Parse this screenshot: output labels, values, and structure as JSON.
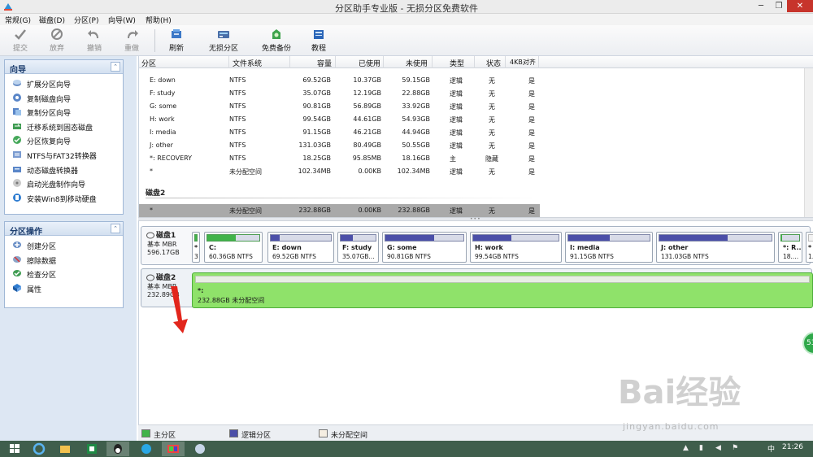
{
  "window": {
    "title": "分区助手专业版 - 无损分区免费软件",
    "minimize": "─",
    "maximize": "❐",
    "close": "✕"
  },
  "menu": [
    "常规(G)",
    "磁盘(D)",
    "分区(P)",
    "向导(W)",
    "帮助(H)"
  ],
  "toolbar": {
    "commit": "提交",
    "discard": "放弃",
    "undo": "撤销",
    "redo": "重做",
    "refresh": "刷新",
    "lossless": "无损分区",
    "backup": "免费备份",
    "tutorial": "教程"
  },
  "wizard": {
    "title": "向导",
    "collapse": "⌃",
    "items": [
      "扩展分区向导",
      "复制磁盘向导",
      "复制分区向导",
      "迁移系统到固态磁盘",
      "分区恢复向导",
      "NTFS与FAT32转换器",
      "动态磁盘转换器",
      "启动光盘制作向导",
      "安装Win8到移动硬盘"
    ]
  },
  "partition_ops": {
    "title": "分区操作",
    "collapse": "⌃",
    "items": [
      "创建分区",
      "擦除数据",
      "检查分区",
      "属性"
    ]
  },
  "table": {
    "headers": [
      "分区",
      "文件系统",
      "容量",
      "已使用",
      "未使用",
      "类型",
      "状态",
      "4KB对齐"
    ],
    "rows": [
      [
        "E: down",
        "NTFS",
        "69.52GB",
        "10.37GB",
        "59.15GB",
        "逻辑",
        "无",
        "是"
      ],
      [
        "F: study",
        "NTFS",
        "35.07GB",
        "12.19GB",
        "22.88GB",
        "逻辑",
        "无",
        "是"
      ],
      [
        "G: some",
        "NTFS",
        "90.81GB",
        "56.89GB",
        "33.92GB",
        "逻辑",
        "无",
        "是"
      ],
      [
        "H: work",
        "NTFS",
        "99.54GB",
        "44.61GB",
        "54.93GB",
        "逻辑",
        "无",
        "是"
      ],
      [
        "I: media",
        "NTFS",
        "91.15GB",
        "46.21GB",
        "44.94GB",
        "逻辑",
        "无",
        "是"
      ],
      [
        "J: other",
        "NTFS",
        "131.03GB",
        "80.49GB",
        "50.55GB",
        "逻辑",
        "无",
        "是"
      ],
      [
        "*: RECOVERY",
        "NTFS",
        "18.25GB",
        "95.85MB",
        "18.16GB",
        "主",
        "隐藏",
        "是"
      ],
      [
        "*",
        "未分配空间",
        "102.34MB",
        "0.00KB",
        "102.34MB",
        "逻辑",
        "无",
        "是"
      ]
    ],
    "disk2_label": "磁盘2",
    "disk2_row": [
      "*",
      "未分配空间",
      "232.88GB",
      "0.00KB",
      "232.88GB",
      "逻辑",
      "无",
      "是"
    ]
  },
  "disk1": {
    "name": "磁盘1",
    "type": "基本 MBR",
    "size": "596.17GB",
    "partitions": [
      {
        "name": "*",
        "size": "3",
        "kind": "primary",
        "used": 0.9
      },
      {
        "name": "C:",
        "size": "60.36GB NTFS",
        "kind": "primary",
        "used": 0.55
      },
      {
        "name": "E: down",
        "size": "69.52GB NTFS",
        "kind": "logic",
        "used": 0.15
      },
      {
        "name": "F: study",
        "size": "35.07GB...",
        "kind": "logic",
        "used": 0.35
      },
      {
        "name": "G: some",
        "size": "90.81GB NTFS",
        "kind": "logic",
        "used": 0.63
      },
      {
        "name": "H: work",
        "size": "99.54GB NTFS",
        "kind": "logic",
        "used": 0.45
      },
      {
        "name": "I: media",
        "size": "91.15GB NTFS",
        "kind": "logic",
        "used": 0.51
      },
      {
        "name": "J: other",
        "size": "131.03GB NTFS",
        "kind": "logic",
        "used": 0.61
      },
      {
        "name": "*: R...",
        "size": "18....",
        "kind": "primary",
        "used": 0.05
      },
      {
        "name": "*",
        "size": "1.",
        "kind": "unalloc",
        "used": 0
      }
    ]
  },
  "disk2": {
    "name": "磁盘2",
    "type": "基本 MBR",
    "size": "232.89GB",
    "partition_name": "*:",
    "partition_size": "232.88GB 未分配空间"
  },
  "legend": {
    "primary": "主分区",
    "logic": "逻辑分区",
    "unalloc": "未分配空间"
  },
  "taskbar": {
    "clock": "21:26",
    "lang": "中"
  },
  "badge": "53",
  "watermark": {
    "brand": "Bai经验",
    "url": "jingyan.baidu.com"
  },
  "colors": {
    "primary": "#41b34a",
    "logic": "#4b4fa8",
    "unalloc_green": "#8fe26a",
    "close_red": "#c7342b"
  }
}
